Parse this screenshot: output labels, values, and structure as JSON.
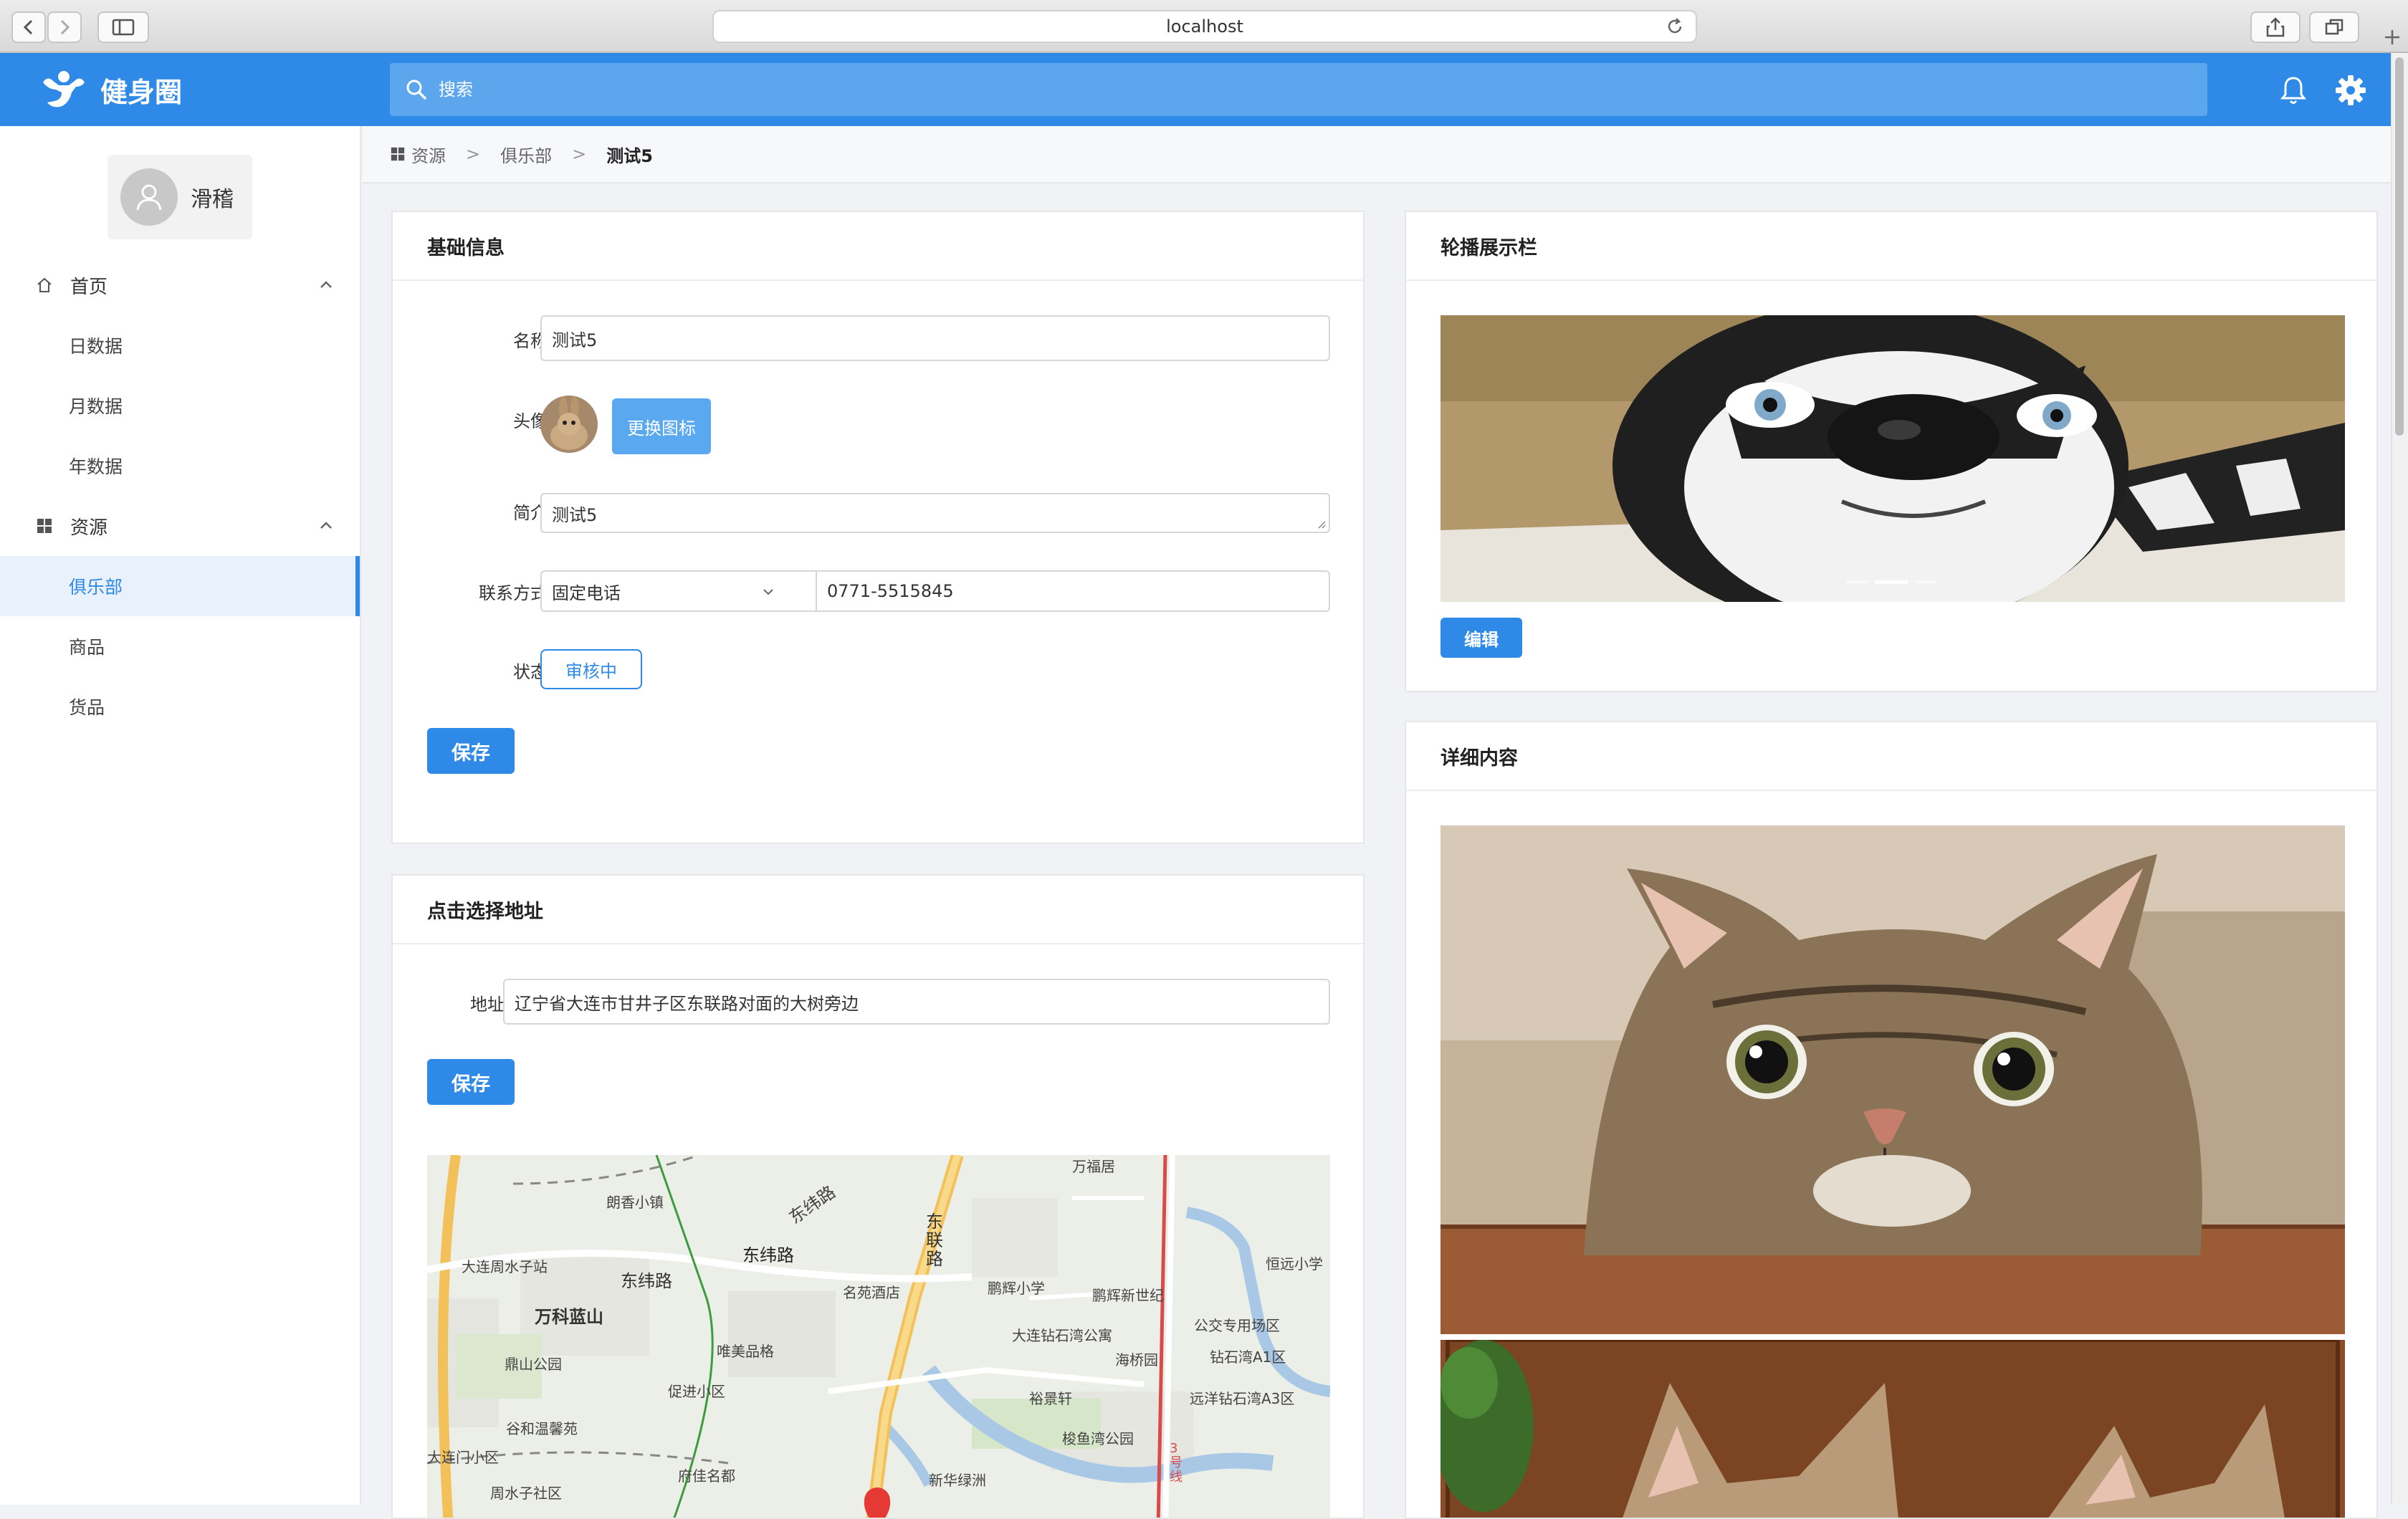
{
  "browser": {
    "url": "localhost"
  },
  "app": {
    "title": "健身圈",
    "search_placeholder": "搜索",
    "accent_color": "#2f89e6"
  },
  "user": {
    "name": "滑稽"
  },
  "sidebar": {
    "groups": [
      {
        "label": "首页",
        "icon": "home-icon",
        "items": [
          "日数据",
          "月数据",
          "年数据"
        ]
      },
      {
        "label": "资源",
        "icon": "grid-icon",
        "items": [
          "俱乐部",
          "商品",
          "货品"
        ]
      }
    ],
    "active_item": "俱乐部"
  },
  "breadcrumb": [
    "资源",
    "俱乐部",
    "测试5"
  ],
  "basic_info": {
    "title": "基础信息",
    "name_label": "名称：",
    "name_value": "测试5",
    "avatar_label": "头像：",
    "change_icon_button": "更换图标",
    "intro_label": "简介：",
    "intro_value": "测试5",
    "contact_label": "联系方式：",
    "contact_type": "固定电话",
    "contact_value": "0771-5515845",
    "status_label": "状态：",
    "status_value": "审核中",
    "save_button": "保存"
  },
  "address": {
    "title": "点击选择地址",
    "label": "地址：",
    "value": "辽宁省大连市甘井子区东联路对面的大树旁边",
    "save_button": "保存",
    "map_labels": {
      "l1": "万福居",
      "l2": "朗香小镇",
      "l3": "东纬路",
      "l4": "东纬路",
      "l5": "东联路",
      "l6": "大连周水子站",
      "l7": "东纬路",
      "l8": "恒远小学",
      "l9": "名苑酒店",
      "l10": "鹏辉小学",
      "l11": "鹏辉新世纪",
      "l12": "万科蓝山",
      "l13": "公交专用场区",
      "l14": "大连钻石湾公寓",
      "l15": "钻石湾A1区",
      "l16": "海桥园",
      "l17": "唯美品格",
      "l18": "鼎山公园",
      "l19": "促进小区",
      "l20": "裕景轩",
      "l21": "远洋钻石湾A3区",
      "l22": "谷和温馨苑",
      "l23": "梭鱼湾公园",
      "l24": "大连门小区",
      "l25": "府佳名都",
      "l26": "新华绿洲",
      "l27": "周水子社区",
      "l28": "3号线"
    }
  },
  "carousel": {
    "title": "轮播展示栏",
    "edit_button": "编辑",
    "slide_count": 3,
    "active_slide": 2
  },
  "detail": {
    "title": "详细内容"
  }
}
